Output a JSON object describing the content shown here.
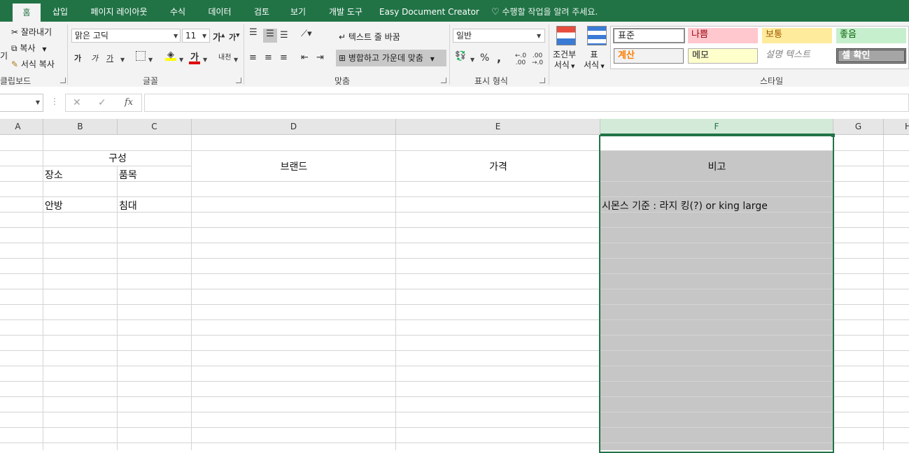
{
  "tabs": [
    {
      "label": "홈",
      "active": true
    },
    {
      "label": "삽입"
    },
    {
      "label": "페이지 레이아웃"
    },
    {
      "label": "수식"
    },
    {
      "label": "데이터"
    },
    {
      "label": "검토"
    },
    {
      "label": "보기"
    },
    {
      "label": "개발 도구"
    },
    {
      "label": "Easy Document Creator"
    }
  ],
  "tell_me": "수행할 작업을 알려 주세요.",
  "clipboard": {
    "cut": "잘라내기",
    "copy": "복사",
    "format_painter": "서식 복사",
    "paste_partial": "기",
    "group_label": "클립보드"
  },
  "font": {
    "name": "맑은 고딕",
    "size": "11",
    "bold": "가",
    "italic": "가",
    "underline": "가",
    "grow": "가",
    "shrink": "가",
    "font_color_glyph": "가",
    "phonetic": "내천",
    "group_label": "글꼴"
  },
  "alignment": {
    "wrap_text": "텍스트 줄 바꿈",
    "merge_center": "병합하고 가운데 맞춤",
    "group_label": "맞춤"
  },
  "number": {
    "format": "일반",
    "percent": "%",
    "comma": ",",
    "group_label": "표시 형식"
  },
  "styles_group": {
    "conditional": [
      "조건부",
      "서식"
    ],
    "table": [
      "표",
      "서식"
    ],
    "cells": [
      {
        "label": "표준",
        "bg": "#ffffff",
        "fg": "#000000"
      },
      {
        "label": "나쁨",
        "bg": "#ffc7ce",
        "fg": "#9c0006"
      },
      {
        "label": "보통",
        "bg": "#ffeb9c",
        "fg": "#9c5700"
      },
      {
        "label": "좋음",
        "bg": "#c6efce",
        "fg": "#006100"
      },
      {
        "label": "계산",
        "bg": "#f2f2f2",
        "fg": "#fa7d00"
      },
      {
        "label": "메모",
        "bg": "#ffffcc",
        "fg": "#000000"
      },
      {
        "label": "설명 텍스트",
        "bg": "#ffffff",
        "fg": "#7f7f7f"
      },
      {
        "label": "셀 확인",
        "bg": "#a5a5a5",
        "fg": "#ffffff"
      }
    ],
    "group_label": "스타일"
  },
  "formula_bar": {
    "cancel": "✕",
    "enter": "✓",
    "fx": "fx",
    "name_box": "",
    "formula": ""
  },
  "columns": [
    "A",
    "B",
    "C",
    "D",
    "E",
    "F",
    "G",
    "H"
  ],
  "selected_column": "F",
  "cells": {
    "b_c_header": "구성",
    "b_sub": "장소",
    "c_sub": "품목",
    "d_header": "브랜드",
    "e_header": "가격",
    "f_header": "비고",
    "b5": "안방",
    "c5": "침대",
    "f5": "시몬스 기준 : 라지 킹(?) or king large"
  },
  "colors": {
    "accent": "#217346",
    "selection_fill": "#c6c6c6",
    "header_selected": "#d3ead9"
  }
}
